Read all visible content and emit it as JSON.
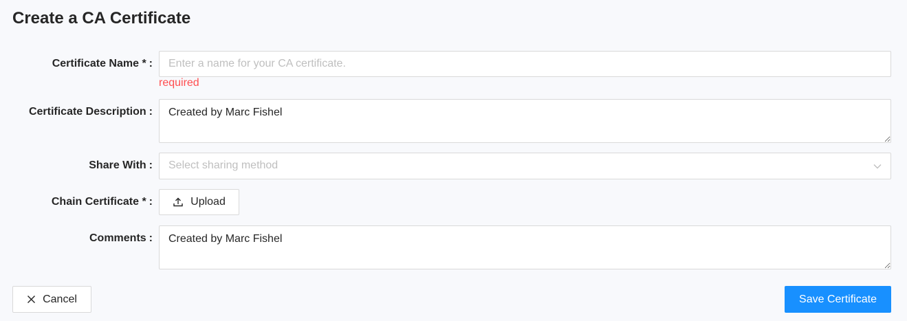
{
  "page": {
    "title": "Create a CA Certificate"
  },
  "form": {
    "certificate_name": {
      "label": "Certificate Name *",
      "colon": ":",
      "value": "",
      "placeholder": "Enter a name for your CA certificate.",
      "error": "required"
    },
    "certificate_description": {
      "label": "Certificate Description",
      "colon": ":",
      "value": "Created by Marc Fishel"
    },
    "share_with": {
      "label": "Share With",
      "colon": ":",
      "placeholder": "Select sharing method"
    },
    "chain_certificate": {
      "label": "Chain Certificate *",
      "colon": ":",
      "button_label": "Upload"
    },
    "comments": {
      "label": "Comments",
      "colon": ":",
      "value": "Created by Marc Fishel"
    }
  },
  "actions": {
    "cancel_label": "Cancel",
    "save_label": "Save Certificate"
  },
  "icons": {
    "upload": "upload-icon",
    "cancel": "close-icon",
    "select": "chevron-down-icon"
  },
  "colors": {
    "primary": "#1890ff",
    "error": "#ff4d4f",
    "border": "#d9d9d9",
    "placeholder": "#bfbfbf",
    "background": "#f8f9fc"
  }
}
